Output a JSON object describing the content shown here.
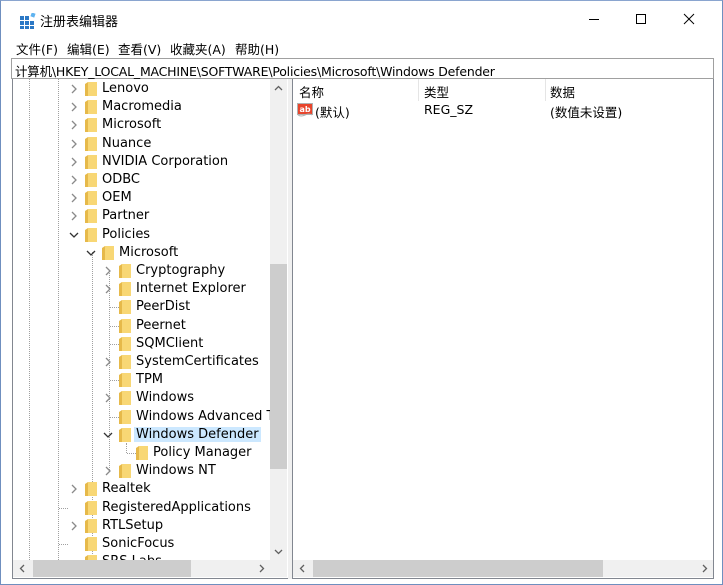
{
  "window": {
    "title": "注册表编辑器",
    "controls": {
      "minimize": "minimize",
      "maximize": "maximize",
      "close": "close"
    }
  },
  "menu": [
    {
      "label": "文件(F)"
    },
    {
      "label": "编辑(E)"
    },
    {
      "label": "查看(V)"
    },
    {
      "label": "收藏夹(A)"
    },
    {
      "label": "帮助(H)"
    }
  ],
  "address": "计算机\\HKEY_LOCAL_MACHINE\\SOFTWARE\\Policies\\Microsoft\\Windows Defender",
  "tree": {
    "items": [
      {
        "label": "Lenovo",
        "level": 0,
        "expander": "collapsed"
      },
      {
        "label": "Macromedia",
        "level": 0,
        "expander": "collapsed"
      },
      {
        "label": "Microsoft",
        "level": 0,
        "expander": "collapsed"
      },
      {
        "label": "Nuance",
        "level": 0,
        "expander": "collapsed"
      },
      {
        "label": "NVIDIA Corporation",
        "level": 0,
        "expander": "collapsed"
      },
      {
        "label": "ODBC",
        "level": 0,
        "expander": "collapsed"
      },
      {
        "label": "OEM",
        "level": 0,
        "expander": "collapsed"
      },
      {
        "label": "Partner",
        "level": 0,
        "expander": "collapsed"
      },
      {
        "label": "Policies",
        "level": 0,
        "expander": "expanded"
      },
      {
        "label": "Microsoft",
        "level": 1,
        "expander": "expanded"
      },
      {
        "label": "Cryptography",
        "level": 2,
        "expander": "collapsed"
      },
      {
        "label": "Internet Explorer",
        "level": 2,
        "expander": "collapsed"
      },
      {
        "label": "PeerDist",
        "level": 2,
        "expander": "none"
      },
      {
        "label": "Peernet",
        "level": 2,
        "expander": "none"
      },
      {
        "label": "SQMClient",
        "level": 2,
        "expander": "none"
      },
      {
        "label": "SystemCertificates",
        "level": 2,
        "expander": "collapsed"
      },
      {
        "label": "TPM",
        "level": 2,
        "expander": "none"
      },
      {
        "label": "Windows",
        "level": 2,
        "expander": "collapsed"
      },
      {
        "label": "Windows Advanced Threat Protection",
        "level": 2,
        "expander": "none"
      },
      {
        "label": "Windows Defender",
        "level": 2,
        "expander": "expanded",
        "selected": true
      },
      {
        "label": "Policy Manager",
        "level": 3,
        "expander": "none"
      },
      {
        "label": "Windows NT",
        "level": 2,
        "expander": "collapsed"
      },
      {
        "label": "Realtek",
        "level": 0,
        "expander": "collapsed"
      },
      {
        "label": "RegisteredApplications",
        "level": 0,
        "expander": "none"
      },
      {
        "label": "RTLSetup",
        "level": 0,
        "expander": "collapsed"
      },
      {
        "label": "SonicFocus",
        "level": 0,
        "expander": "none"
      },
      {
        "label": "SRS Labs",
        "level": 0,
        "expander": "none"
      }
    ]
  },
  "list": {
    "columns": [
      {
        "label": "名称"
      },
      {
        "label": "类型"
      },
      {
        "label": "数据"
      }
    ],
    "rows": [
      {
        "name": "(默认)",
        "type": "REG_SZ",
        "data": "(数值未设置)",
        "icon": "string-value-icon"
      }
    ]
  },
  "colors": {
    "selection": "#cce8ff",
    "folder": "#f8d775",
    "scroll_thumb": "#cdcdcd",
    "scroll_track": "#f0f0f0"
  }
}
